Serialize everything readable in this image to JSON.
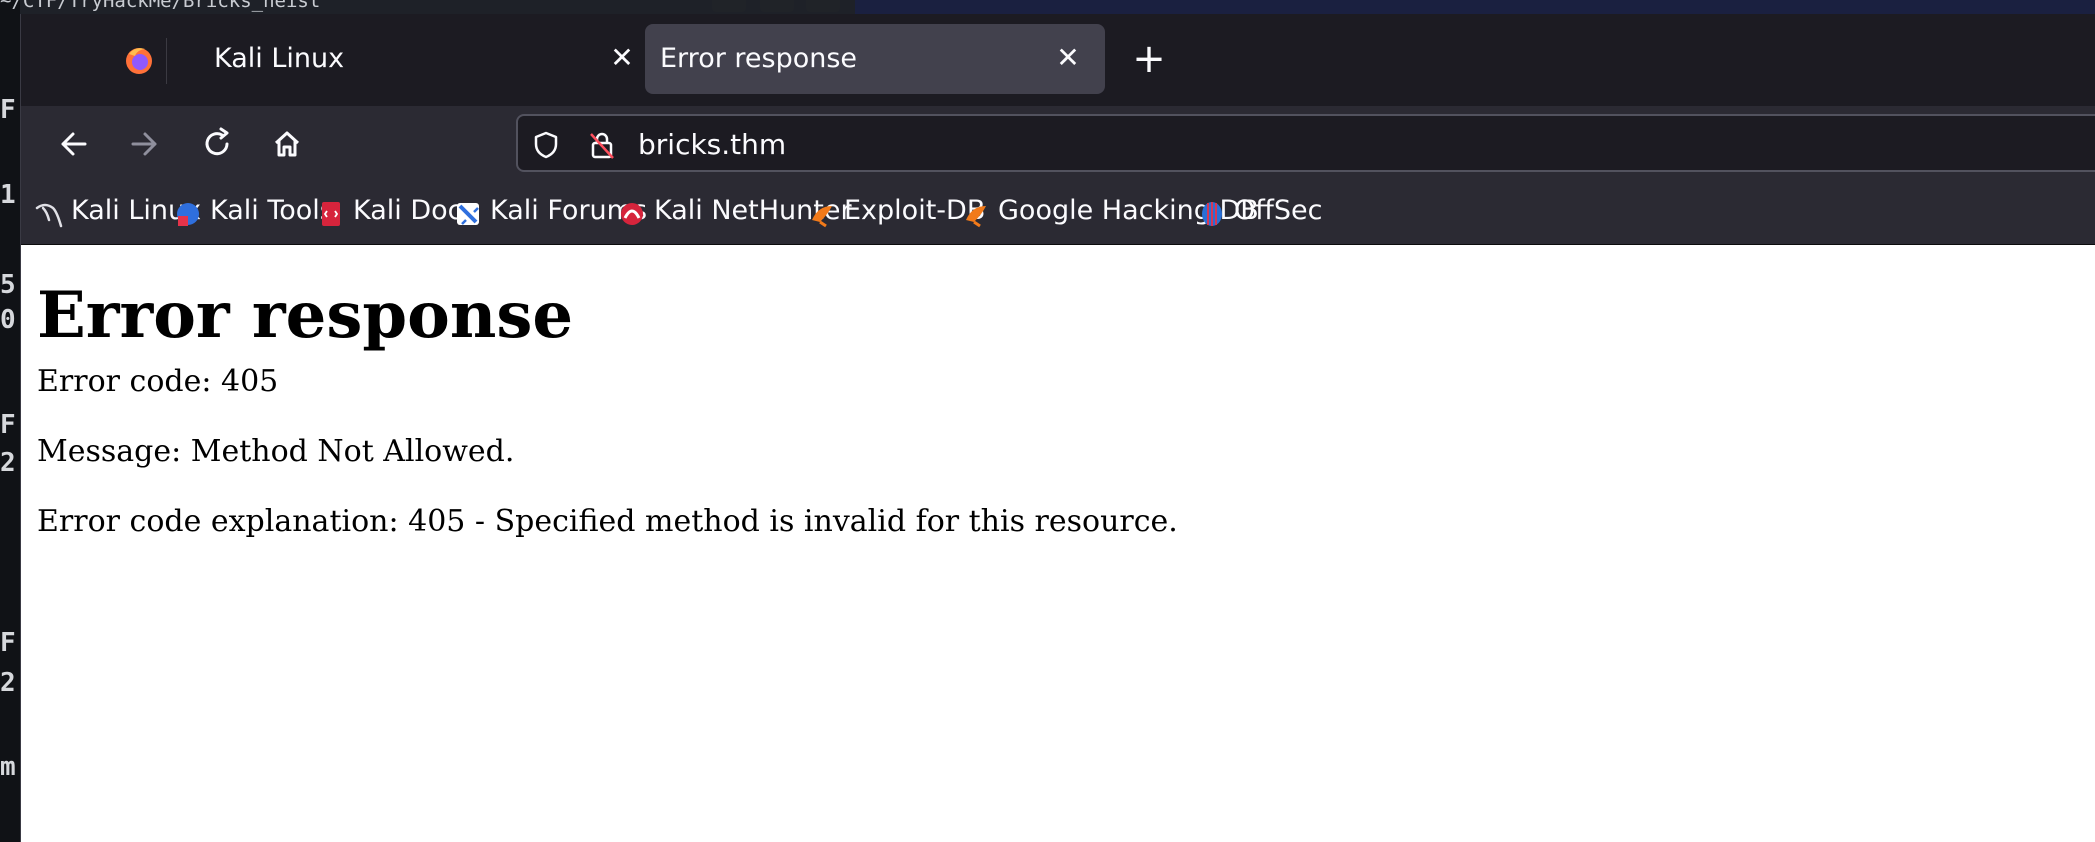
{
  "terminal": {
    "title_fragment": "~/CTF/TryHackMe/Bricks_heist",
    "fragments": [
      "F",
      "1",
      "5",
      "0",
      "F",
      "2",
      "",
      "F",
      "2",
      "",
      "m"
    ]
  },
  "browser": {
    "tabs": [
      {
        "label": "Kali Linux",
        "active": false
      },
      {
        "label": "Error response",
        "active": true
      }
    ],
    "new_tab_label": "+",
    "close_glyph": "✕",
    "url": "bricks.thm",
    "bookmarks": [
      {
        "label": "Kali Linux",
        "icon": "kali-dragon-icon"
      },
      {
        "label": "Kali Tools",
        "icon": "kali-tools-icon"
      },
      {
        "label": "Kali Docs",
        "icon": "kali-docs-icon"
      },
      {
        "label": "Kali Forums",
        "icon": "kali-forums-icon"
      },
      {
        "label": "Kali NetHunter",
        "icon": "kali-nethunter-icon"
      },
      {
        "label": "Exploit-DB",
        "icon": "exploit-db-icon"
      },
      {
        "label": "Google Hacking DB",
        "icon": "ghdb-icon"
      },
      {
        "label": "OffSec",
        "icon": "offsec-icon"
      }
    ]
  },
  "page": {
    "heading": "Error response",
    "error_code": "Error code: 405",
    "message": "Message: Method Not Allowed.",
    "explanation": "Error code explanation: 405 - Specified method is invalid for this resource."
  },
  "colors": {
    "tab_active_bg": "#42414d",
    "toolbar_bg": "#2b2a33",
    "frame_bg": "#1c1b22",
    "text_light": "#fbfbfe"
  }
}
